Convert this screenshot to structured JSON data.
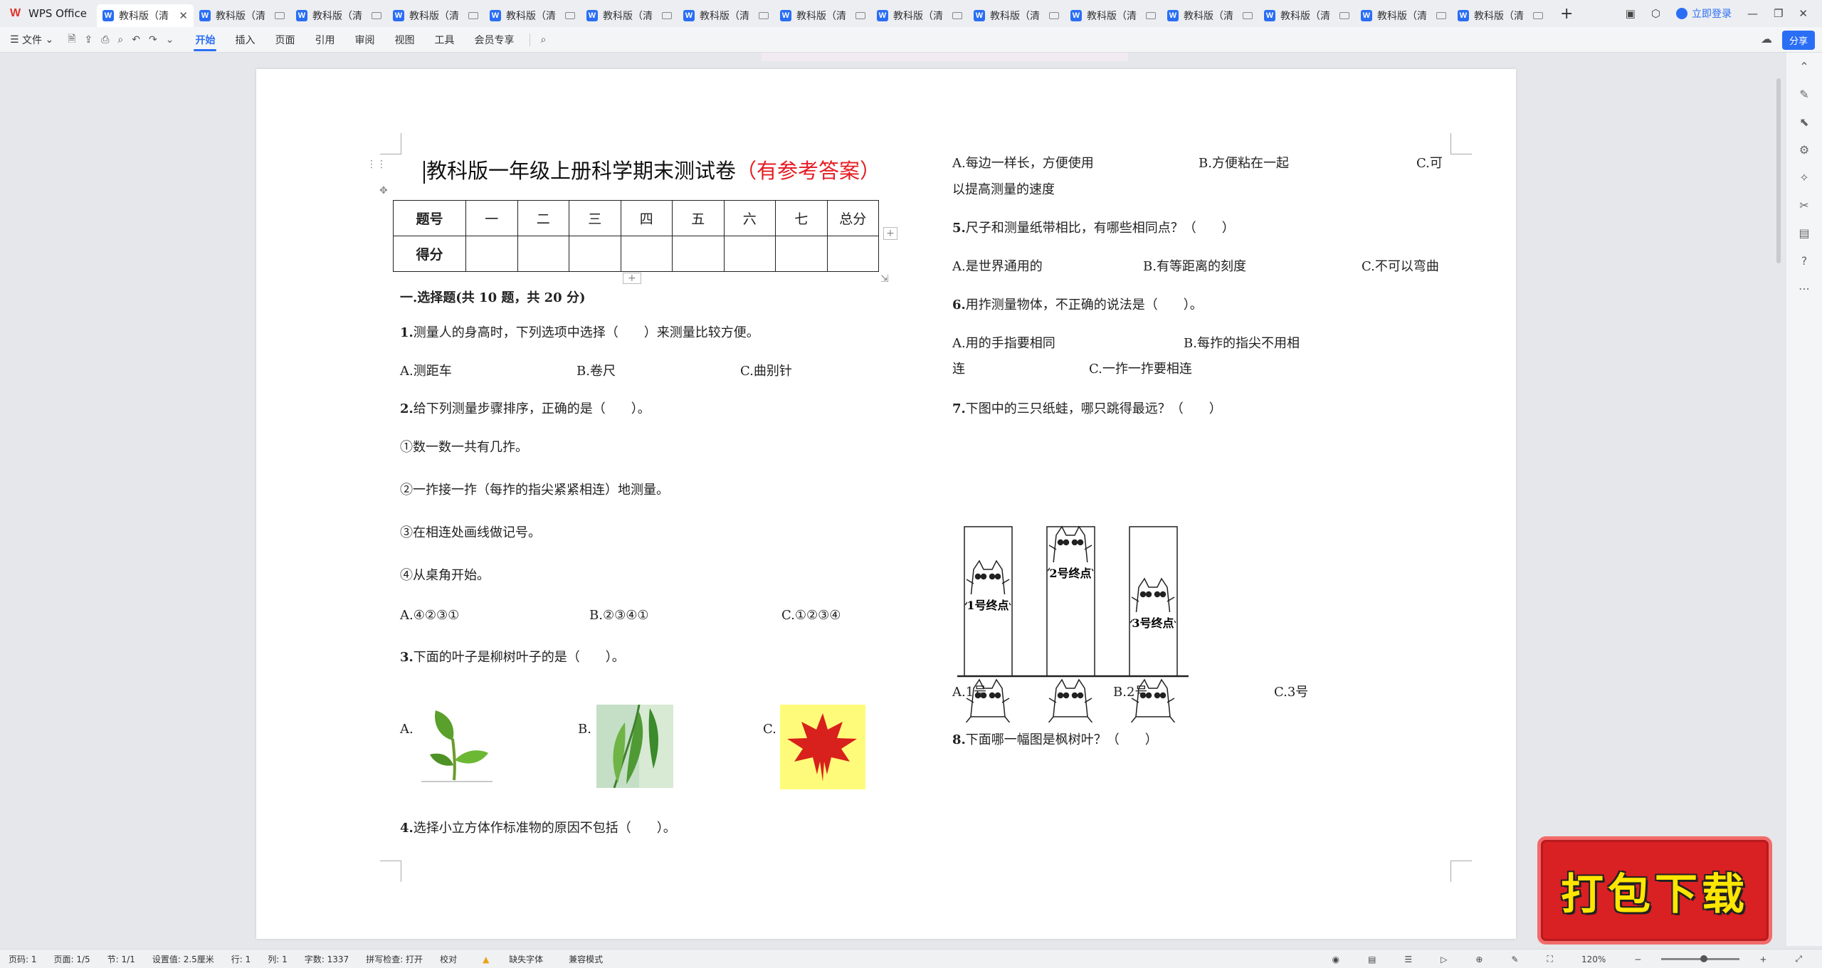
{
  "window": {
    "app_name": "WPS Office",
    "tabs": [
      {
        "label": "教科版（清",
        "active": true
      },
      {
        "label": "教科版（清"
      },
      {
        "label": "教科版（清"
      },
      {
        "label": "教科版（清"
      },
      {
        "label": "教科版（清"
      },
      {
        "label": "教科版（清"
      },
      {
        "label": "教科版（清"
      },
      {
        "label": "教科版（清"
      },
      {
        "label": "教科版（清"
      },
      {
        "label": "教科版（清"
      },
      {
        "label": "教科版（清"
      },
      {
        "label": "教科版（清"
      },
      {
        "label": "教科版（清"
      },
      {
        "label": "教科版（清"
      },
      {
        "label": "教科版（清"
      }
    ],
    "login_label": "立即登录",
    "share_label": "分享"
  },
  "ribbon": {
    "file_label": "文件",
    "tabs": [
      "开始",
      "插入",
      "页面",
      "引用",
      "审阅",
      "视图",
      "工具",
      "会员专享"
    ],
    "active_tab": "开始"
  },
  "document": {
    "title_main": "教科版一年级上册科学期末测试卷",
    "title_red": "（有参考答案）",
    "score_table": {
      "row1": [
        "题号",
        "一",
        "二",
        "三",
        "四",
        "五",
        "六",
        "七",
        "总分"
      ],
      "row2_label": "得分"
    },
    "section1": "一.选择题(共 10 题，共 20 分)",
    "q1": {
      "num": "1.",
      "text": "测量人的身高时，下列选项中选择（　　）来测量比较方便。",
      "options": [
        "A.测距车",
        "B.卷尺",
        "C.曲别针"
      ]
    },
    "q2": {
      "num": "2.",
      "text": "给下列测量步骤排序，正确的是（　　）。",
      "steps": [
        "①数一数一共有几拃。",
        "②一拃接一拃（每拃的指尖紧紧相连）地测量。",
        "③在相连处画线做记号。",
        "④从桌角开始。"
      ],
      "options": [
        "A.④②③①",
        "B.②③④①",
        "C.①②③④"
      ]
    },
    "q3": {
      "num": "3.",
      "text": "下面的叶子是柳树叶子的是（　　）。",
      "options": [
        "A.",
        "B.",
        "C."
      ]
    },
    "q4": {
      "num": "4.",
      "text": "选择小立方体作标准物的原因不包括（　　）。",
      "options": [
        "A.每边一样长，方便使用",
        "B.方便粘在一起",
        "C.可"
      ],
      "cont": "以提高测量的速度"
    },
    "q5": {
      "num": "5.",
      "text": "尺子和测量纸带相比，有哪些相同点？（　　）",
      "options": [
        "A.是世界通用的",
        "B.有等距离的刻度",
        "C.不可以弯曲"
      ]
    },
    "q6": {
      "num": "6.",
      "text": "用拃测量物体，不正确的说法是（　　）。",
      "options": [
        "A.用的手指要相同",
        "B.每拃的指尖不用相"
      ],
      "cont": "连",
      "cont_option": "C.一拃一拃要相连"
    },
    "q7": {
      "num": "7.",
      "text": "下图中的三只纸蛙，哪只跳得最远？（　　）",
      "figure_labels": [
        "1号终点",
        "2号终点",
        "3号终点"
      ],
      "options": [
        "A.1号",
        "B.2号",
        "C.3号"
      ]
    },
    "q8": {
      "num": "8.",
      "text": "下面哪一幅图是枫树叶？（　　）"
    }
  },
  "download_badge": "打包下载",
  "status": {
    "page_num": "页码: 1",
    "pages": "页面: 1/5",
    "section": "节: 1/1",
    "setting": "设置值: 2.5厘米",
    "row": "行: 1",
    "col": "列: 1",
    "words": "字数: 1337",
    "spell": "拼写检查: 打开",
    "proof": "校对",
    "missing_font": "缺失字体",
    "compat": "兼容模式",
    "zoom": "120%"
  }
}
